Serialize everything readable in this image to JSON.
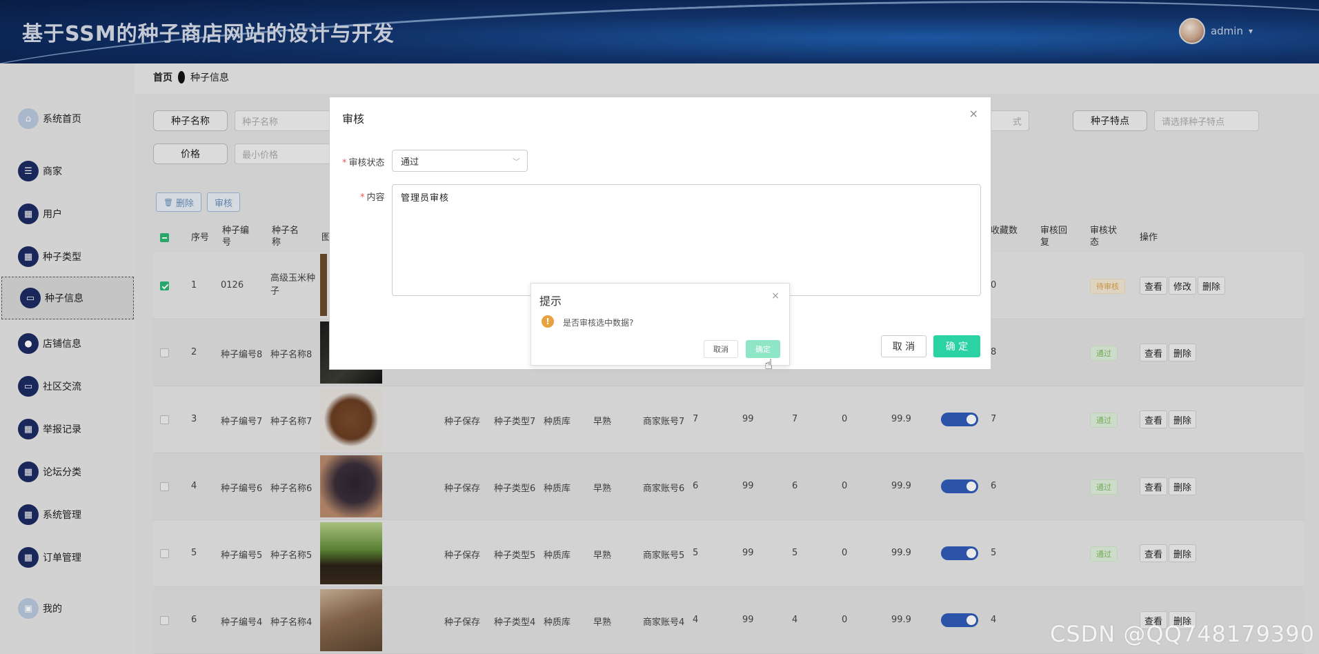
{
  "header": {
    "title": "基于SSM的种子商店网站的设计与开发",
    "username": "admin",
    "dropdown_glyph": "▾"
  },
  "breadcrumb": {
    "home": "首页",
    "current": "种子信息"
  },
  "sidebar": {
    "items": [
      {
        "label": "系统首页",
        "icon": "home-icon"
      },
      {
        "label": "商家",
        "icon": "sliders-icon"
      },
      {
        "label": "用户",
        "icon": "grid-icon"
      },
      {
        "label": "种子类型",
        "icon": "grid-icon"
      },
      {
        "label": "种子信息",
        "icon": "monitor-icon",
        "active": true
      },
      {
        "label": "店铺信息",
        "icon": "person-icon"
      },
      {
        "label": "社区交流",
        "icon": "monitor-icon"
      },
      {
        "label": "举报记录",
        "icon": "grid-icon"
      },
      {
        "label": "论坛分类",
        "icon": "grid-icon"
      },
      {
        "label": "系统管理",
        "icon": "grid-icon"
      },
      {
        "label": "订单管理",
        "icon": "grid-icon"
      },
      {
        "label": "我的",
        "icon": "window-icon"
      }
    ]
  },
  "search": {
    "name_label": "种子名称",
    "name_placeholder": "种子名称",
    "price_label": "价格",
    "price_placeholder": "最小价格",
    "feature_label": "种子特点",
    "feature_placeholder": "请选择种子特点",
    "partial_placeholder": "式"
  },
  "toolbar": {
    "delete_label": "删除",
    "review_label": "审核"
  },
  "table": {
    "headers": {
      "index": "序号",
      "code": "种子编号",
      "name": "种子名称",
      "image": "图",
      "favorites": "收藏数",
      "reply": "审核回复",
      "status": "审核状态",
      "actions": "操作"
    },
    "rows": [
      {
        "idx": "1",
        "code": "0126",
        "name": "高级玉米种子",
        "fav": "0",
        "status": "待审核",
        "status_type": "wait",
        "checked": true,
        "actions": [
          "查看",
          "修改",
          "删除"
        ]
      },
      {
        "idx": "2",
        "code": "种子编号8",
        "name": "种子名称8",
        "fav": "8",
        "status": "通过",
        "status_type": "ok",
        "actions": [
          "查看",
          "删除"
        ]
      },
      {
        "idx": "3",
        "code": "种子编号7",
        "name": "种子名称7",
        "storage": "种子保存",
        "type": "种子类型7",
        "quality": "种质库",
        "maturity": "早熟",
        "shop": "商家账号7",
        "n1": "7",
        "n2": "99",
        "n3": "7",
        "n4": "0",
        "price": "99.9",
        "fav": "7",
        "status": "通过",
        "status_type": "ok",
        "actions": [
          "查看",
          "删除"
        ]
      },
      {
        "idx": "4",
        "code": "种子编号6",
        "name": "种子名称6",
        "storage": "种子保存",
        "type": "种子类型6",
        "quality": "种质库",
        "maturity": "早熟",
        "shop": "商家账号6",
        "n1": "6",
        "n2": "99",
        "n3": "6",
        "n4": "0",
        "price": "99.9",
        "fav": "6",
        "status": "通过",
        "status_type": "ok",
        "actions": [
          "查看",
          "删除"
        ]
      },
      {
        "idx": "5",
        "code": "种子编号5",
        "name": "种子名称5",
        "storage": "种子保存",
        "type": "种子类型5",
        "quality": "种质库",
        "maturity": "早熟",
        "shop": "商家账号5",
        "n1": "5",
        "n2": "99",
        "n3": "5",
        "n4": "0",
        "price": "99.9",
        "fav": "5",
        "status": "通过",
        "status_type": "ok",
        "actions": [
          "查看",
          "删除"
        ]
      },
      {
        "idx": "6",
        "code": "种子编号4",
        "name": "种子名称4",
        "storage": "种子保存",
        "type": "种子类型4",
        "quality": "种质库",
        "maturity": "早熟",
        "shop": "商家账号4",
        "n1": "4",
        "n2": "99",
        "n3": "4",
        "n4": "0",
        "price": "99.9",
        "fav": "4",
        "status": "",
        "status_type": "",
        "actions": [
          "查看",
          "删除"
        ]
      }
    ]
  },
  "dialog": {
    "title": "审核",
    "close_glyph": "×",
    "required_mark": "*",
    "status_label": "审核状态",
    "status_value": "通过",
    "content_label": "内容",
    "content_value": "管理员审核",
    "cancel_label": "取 消",
    "confirm_label": "确 定"
  },
  "confirm": {
    "title": "提示",
    "warn_glyph": "!",
    "message": "是否审核选中数据?",
    "cancel_label": "取消",
    "ok_label": "确定"
  },
  "watermark": "CSDN @QQ748179390",
  "colors": {
    "accent": "#2bd2a4",
    "nav": "#1d2b63",
    "toggle": "#2f5bb7",
    "warn": "#e6a23c"
  }
}
